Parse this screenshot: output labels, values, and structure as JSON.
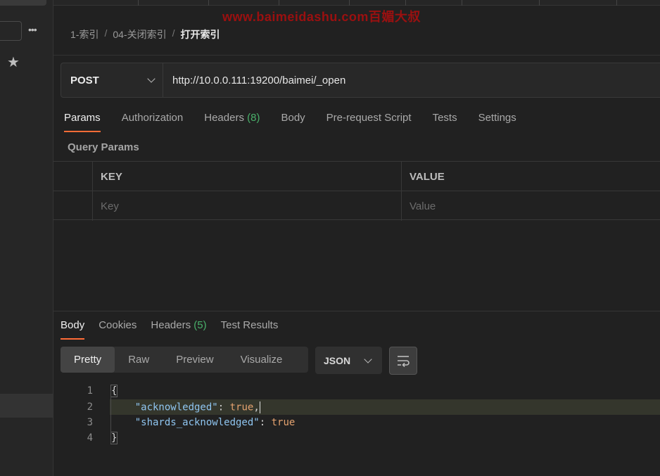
{
  "watermark": "www.baimeidashu.com百媚大叔",
  "breadcrumb": {
    "items": [
      "1-索引",
      "04-关闭索引"
    ],
    "current": "打开索引"
  },
  "request": {
    "method": "POST",
    "url": "http://10.0.0.111:19200/baimei/_open"
  },
  "request_tabs": [
    {
      "label": "Params",
      "active": true
    },
    {
      "label": "Authorization"
    },
    {
      "label": "Headers",
      "count": "(8)"
    },
    {
      "label": "Body"
    },
    {
      "label": "Pre-request Script"
    },
    {
      "label": "Tests"
    },
    {
      "label": "Settings"
    }
  ],
  "query_params": {
    "title": "Query Params",
    "columns": [
      "KEY",
      "VALUE"
    ],
    "placeholders": {
      "key": "Key",
      "value": "Value"
    }
  },
  "response_tabs": [
    {
      "label": "Body",
      "active": true
    },
    {
      "label": "Cookies"
    },
    {
      "label": "Headers",
      "count": "(5)"
    },
    {
      "label": "Test Results"
    }
  ],
  "view_modes": [
    "Pretty",
    "Raw",
    "Preview",
    "Visualize"
  ],
  "active_view_mode": "Pretty",
  "format": "JSON",
  "response_body": {
    "line_numbers": [
      "1",
      "2",
      "3",
      "4"
    ],
    "open_brace": "{",
    "close_brace": "}",
    "key1": "\"acknowledged\"",
    "value1": "true",
    "key2": "\"shards_acknowledged\"",
    "value2": "true"
  },
  "sidebar": {
    "more_icon": "•••",
    "star_icon": "★"
  },
  "colors": {
    "accent": "#ff6c37",
    "count_green": "#49b06a",
    "json_key": "#8fc5f0",
    "json_value": "#e4a26f"
  }
}
